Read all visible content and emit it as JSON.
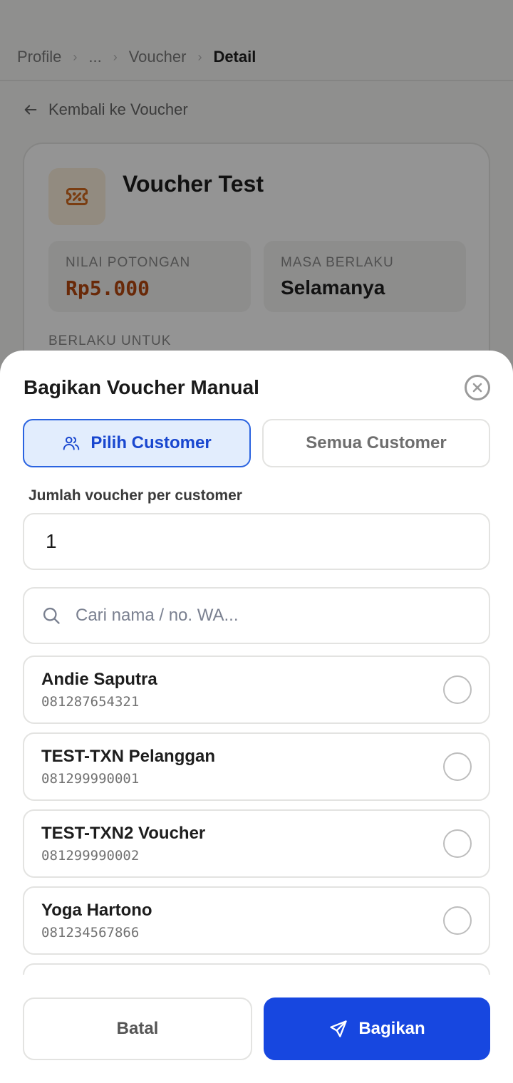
{
  "breadcrumb": {
    "items": [
      "Profile",
      "...",
      "Voucher",
      "Detail"
    ]
  },
  "back_link": {
    "label": "Kembali ke Voucher"
  },
  "voucher": {
    "title": "Voucher Test",
    "discount_label": "NILAI POTONGAN",
    "discount_value": "Rp5.000",
    "validity_label": "MASA BERLAKU",
    "validity_value": "Selamanya",
    "applies_label": "BERLAKU UNTUK"
  },
  "sheet": {
    "title": "Bagikan Voucher Manual",
    "mode_active": "Pilih Customer",
    "mode_inactive": "Semua Customer",
    "qty_label": "Jumlah voucher per customer",
    "qty_value": "1",
    "search_placeholder": "Cari nama / no. WA...",
    "customers": [
      {
        "name": "Andie Saputra",
        "phone": "081287654321"
      },
      {
        "name": "TEST-TXN Pelanggan",
        "phone": "081299990001"
      },
      {
        "name": "TEST-TXN2 Voucher",
        "phone": "081299990002"
      },
      {
        "name": "Yoga Hartono",
        "phone": "081234567866"
      },
      {
        "name": "",
        "phone": ""
      }
    ],
    "cancel_label": "Batal",
    "share_label": "Bagikan"
  },
  "colors": {
    "primary": "#1747e0",
    "active_tab_bg": "#e2edfd",
    "discount": "#b5470f"
  },
  "icons": [
    "arrow-left-icon",
    "ticket-percent-icon",
    "close-circle-icon",
    "users-icon",
    "search-icon",
    "send-icon"
  ]
}
